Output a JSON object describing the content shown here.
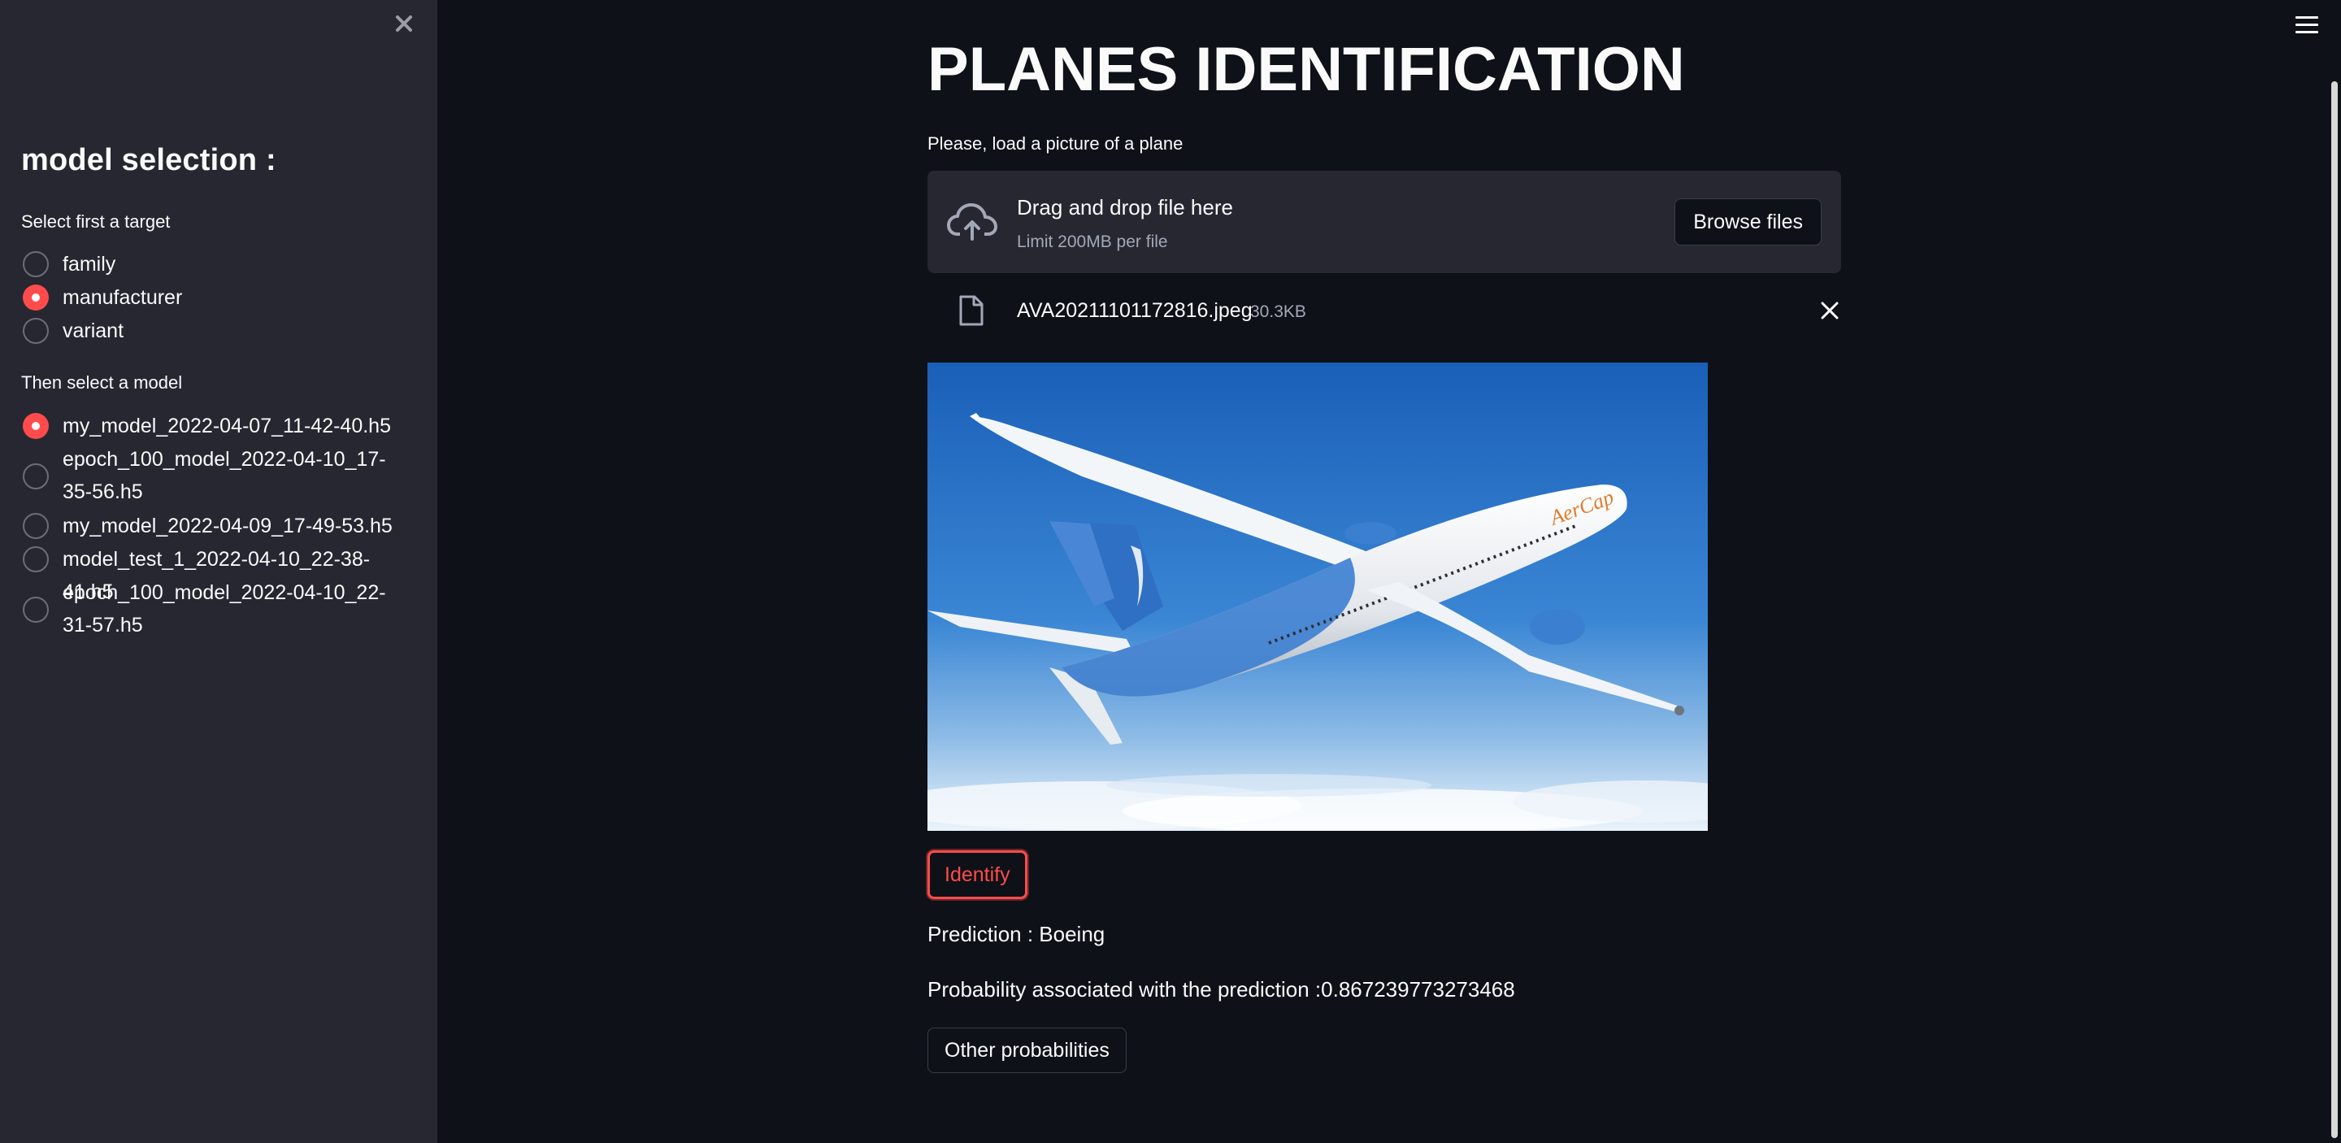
{
  "sidebar": {
    "title": "model selection :",
    "target_label": "Select first a target",
    "targets": [
      {
        "label": "family",
        "checked": false
      },
      {
        "label": "manufacturer",
        "checked": true
      },
      {
        "label": "variant",
        "checked": false
      }
    ],
    "model_label": "Then select a model",
    "models": [
      {
        "label": "my_model_2022-04-07_11-42-40.h5",
        "checked": true
      },
      {
        "label": "epoch_100_model_2022-04-10_17-35-56.h5",
        "checked": false
      },
      {
        "label": "my_model_2022-04-09_17-49-53.h5",
        "checked": false
      },
      {
        "label": "model_test_1_2022-04-10_22-38-41.h5",
        "checked": false
      },
      {
        "label": "epoch_100_model_2022-04-10_22-31-57.h5",
        "checked": false
      }
    ]
  },
  "main": {
    "title": "PLANES IDENTIFICATION",
    "upload_label": "Please, load a picture of a plane",
    "dropzone": {
      "title": "Drag and drop file here",
      "limit": "Limit 200MB per file",
      "browse_label": "Browse files"
    },
    "file": {
      "name": "AVA20211101172816.jpeg",
      "size": "30.3KB"
    },
    "image": {
      "tail_text": "AerCap"
    },
    "identify_label": "Identify",
    "prediction_text": "Prediction : Boeing",
    "probability_text": "Probability associated with the prediction :0.867239773273468",
    "other_label": "Other probabilities"
  },
  "colors": {
    "accent": "#ff4b4b",
    "sidebar_bg": "#262730",
    "main_bg": "#0e1117"
  }
}
